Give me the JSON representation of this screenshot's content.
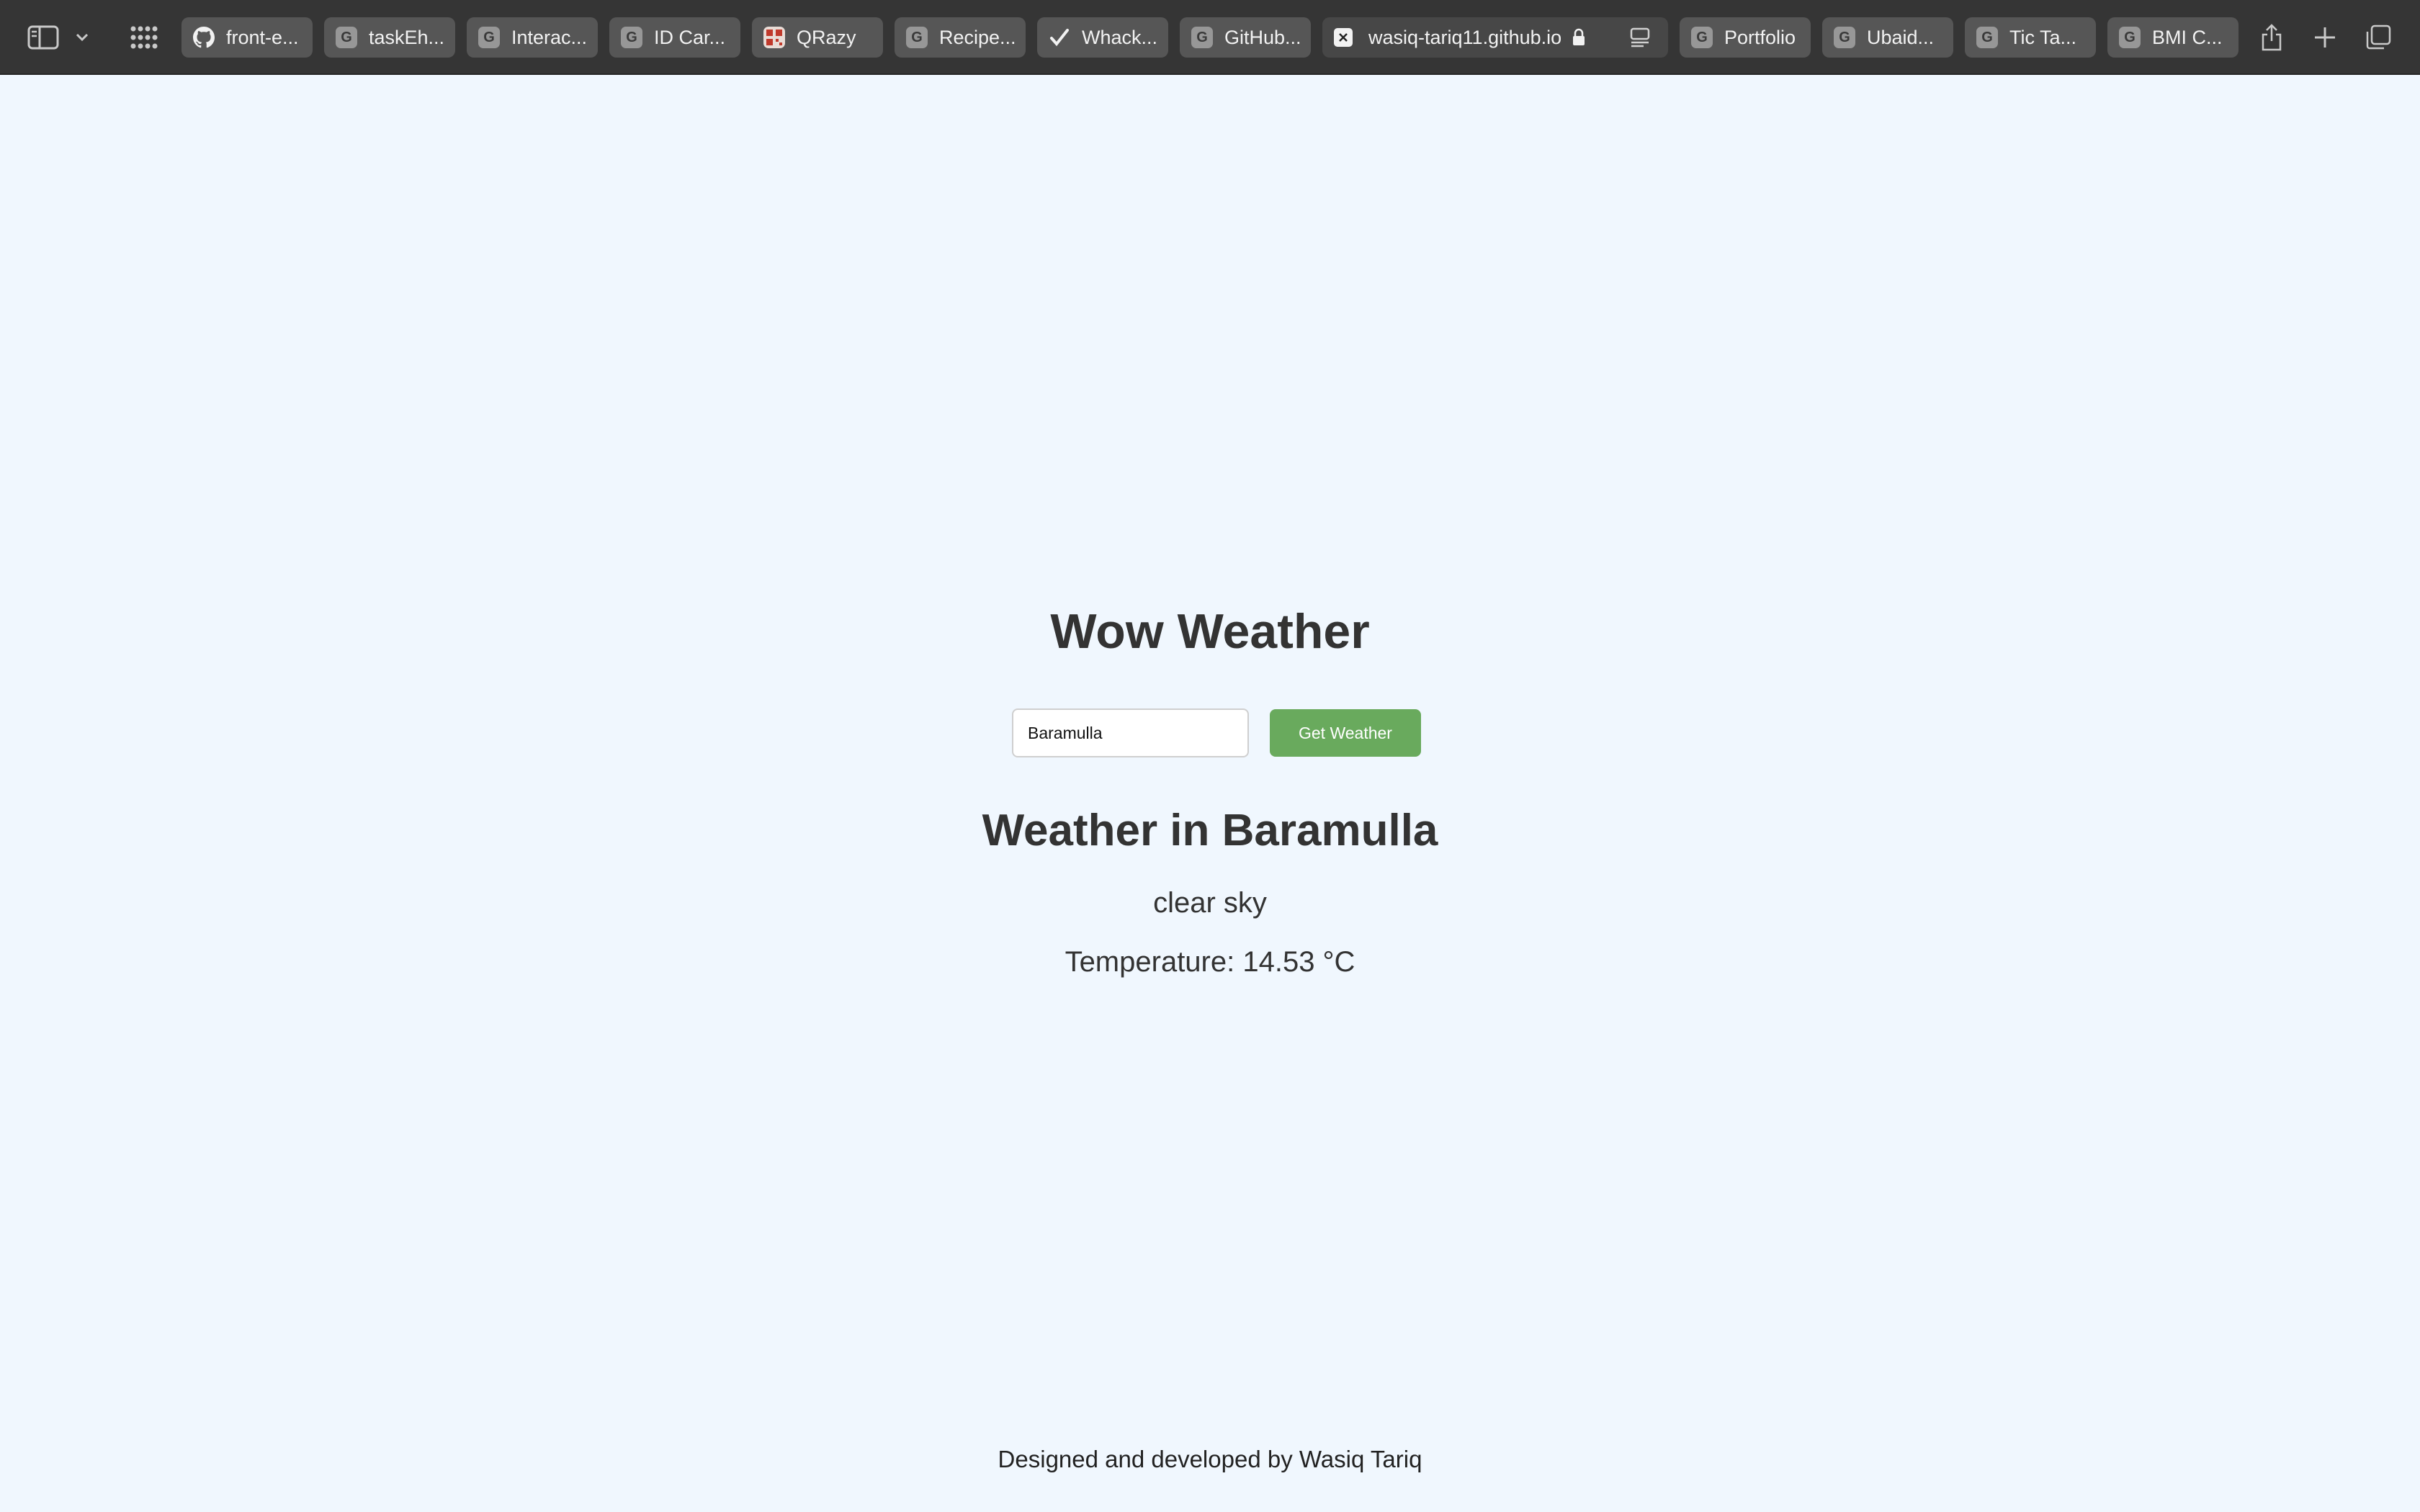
{
  "browser": {
    "tabs": [
      {
        "label": "front-e...",
        "favicon": "github-icon"
      },
      {
        "label": "taskEh...",
        "favicon": "g-letter-icon"
      },
      {
        "label": "Interac...",
        "favicon": "g-letter-icon"
      },
      {
        "label": "ID Car...",
        "favicon": "g-letter-icon"
      },
      {
        "label": "QRazy",
        "favicon": "qr-code-icon"
      },
      {
        "label": "Recipe...",
        "favicon": "g-letter-icon"
      },
      {
        "label": "Whack...",
        "favicon": "checkmark-icon"
      },
      {
        "label": "GitHub...",
        "favicon": "g-letter-icon"
      },
      {
        "label": "wasiq-tariq11.github.io",
        "favicon": "close-icon",
        "active": true
      },
      {
        "label": "Portfolio",
        "favicon": "g-letter-icon"
      },
      {
        "label": "Ubaid...",
        "favicon": "g-letter-icon"
      },
      {
        "label": "Tic Ta...",
        "favicon": "g-letter-icon"
      },
      {
        "label": "BMI C...",
        "favicon": "g-letter-icon"
      }
    ],
    "favicon_letter": "G"
  },
  "app": {
    "title": "Wow Weather",
    "search": {
      "value": "Baramulla",
      "button_label": "Get Weather"
    },
    "result": {
      "heading": "Weather in Baramulla",
      "description": "clear sky",
      "temperature": "Temperature: 14.53 °C"
    },
    "footer": "Designed and developed by Wasiq Tariq"
  },
  "colors": {
    "page_background": "#f0f7fe",
    "button": "#69aa5d",
    "toolbar": "#353535",
    "text": "#333333"
  }
}
